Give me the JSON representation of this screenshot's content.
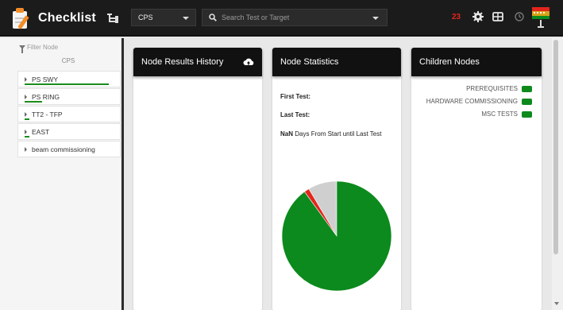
{
  "app": {
    "title": "Checklist"
  },
  "header": {
    "project_select": "CPS",
    "search_placeholder": "Search Test or Target",
    "notification_count": "23"
  },
  "sidebar": {
    "filter_placeholder": "Filter Node",
    "root_label": "CPS",
    "items": [
      {
        "label": "PS SWY",
        "progress": 0.95
      },
      {
        "label": "PS RING",
        "progress": 0.2
      },
      {
        "label": "TT2 - TFP",
        "progress": 0.05
      },
      {
        "label": "EAST",
        "progress": 0.05
      },
      {
        "label": "beam commissioning",
        "progress": 0
      }
    ]
  },
  "cards": {
    "history_title": "Node Results History",
    "statistics_title": "Node Statistics",
    "children_title": "Children Nodes",
    "first_test_label": "First Test:",
    "last_test_label": "Last Test:",
    "nan_value": "NaN",
    "days_text": "Days From Start until Last Test"
  },
  "children": [
    {
      "label": "PREREQUISITES",
      "color": "#0c8a1d"
    },
    {
      "label": "HARDWARE COMMISSIONING",
      "color": "#0c8a1d"
    },
    {
      "label": "MSC TESTS",
      "color": "#0c8a1d"
    }
  ],
  "colors": {
    "topbar": "#1b1b1b",
    "accent_green": "#0c8a1d",
    "alert_red": "#e3251d"
  },
  "chart_data": {
    "type": "pie",
    "slices": [
      {
        "name": "",
        "value": 90,
        "color": "#0c8a1d"
      },
      {
        "name": "",
        "value": 1.5,
        "color": "#e3251d"
      },
      {
        "name": "",
        "value": 8.5,
        "color": "#cfcfcf"
      }
    ]
  },
  "icons": [
    "checklist-logo-icon",
    "tree-view-icon",
    "search-icon",
    "gear-icon",
    "dashboard-icon",
    "history-icon",
    "status-indicator-icon",
    "cloud-upload-icon",
    "filter-icon"
  ]
}
